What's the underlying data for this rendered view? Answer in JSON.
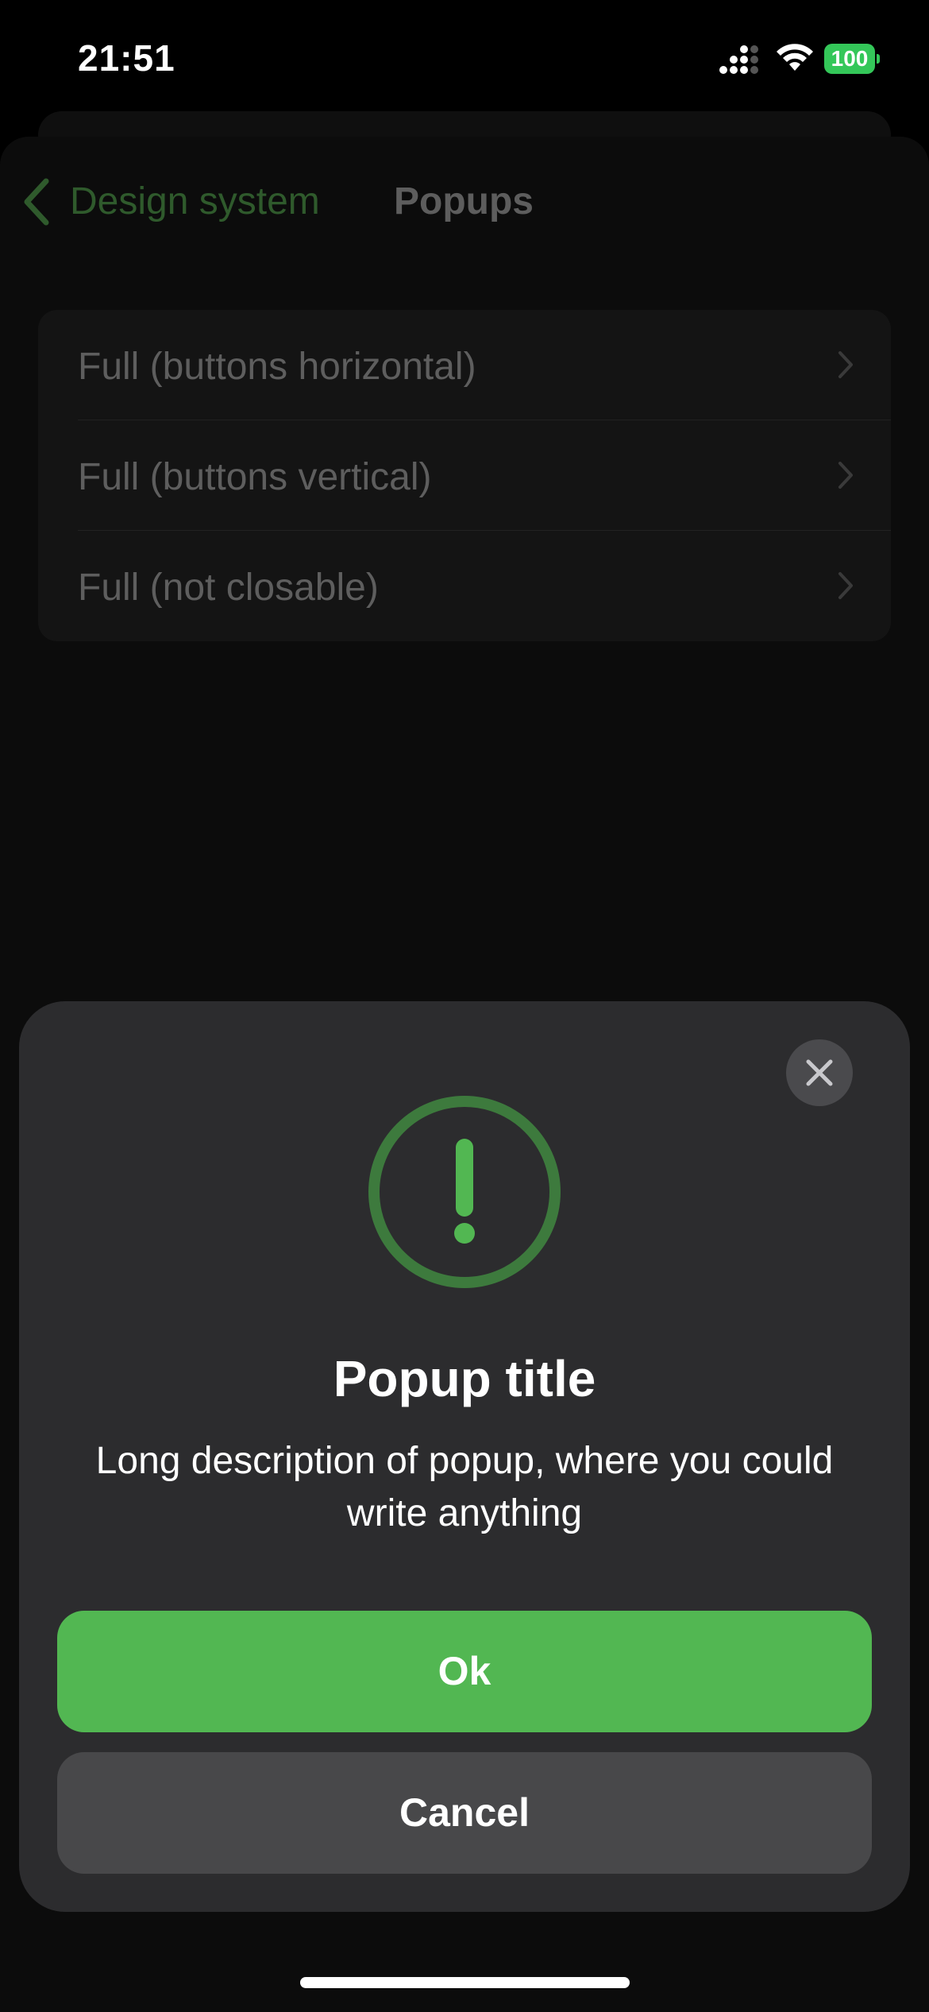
{
  "status_bar": {
    "time": "21:51",
    "battery": "100"
  },
  "nav": {
    "back_label": "Design system",
    "title": "Popups"
  },
  "list": {
    "items": [
      {
        "label": "Full (buttons horizontal)"
      },
      {
        "label": "Full (buttons vertical)"
      },
      {
        "label": "Full (not closable)"
      }
    ]
  },
  "popup": {
    "icon": "exclamation-circle-icon",
    "title": "Popup title",
    "description": "Long description of popup, where you could write anything",
    "ok_label": "Ok",
    "cancel_label": "Cancel"
  },
  "colors": {
    "accent": "#52b752",
    "popup_bg": "#2c2c2e",
    "secondary_button": "#48484a",
    "battery": "#34c759"
  }
}
